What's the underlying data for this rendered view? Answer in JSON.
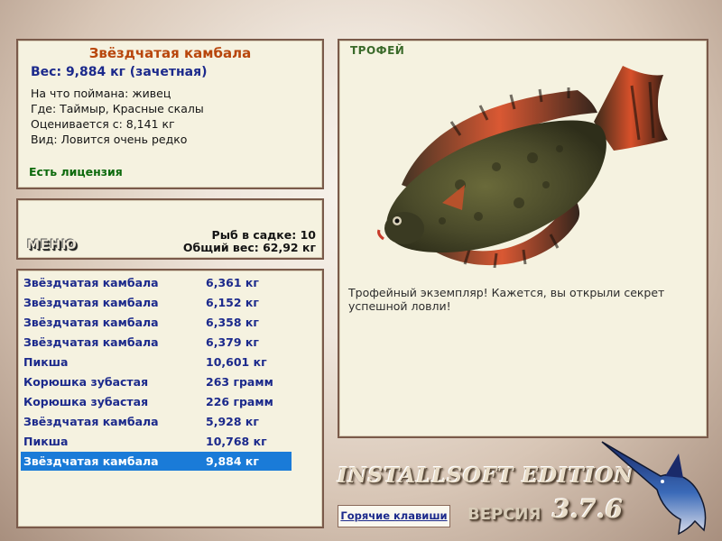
{
  "info": {
    "fish_name": "Звёздчатая камбала",
    "weight": "Вес: 9,884 кг (зачетная)",
    "bait": "На что поймана: живец",
    "location": "Где: Таймыр, Красные скалы",
    "valued_from": "Оценивается с: 8,141 кг",
    "species_note": "Вид: Ловится очень редко",
    "license": "Есть лицензия"
  },
  "menu": {
    "menu_label": "МЕНЮ",
    "fish_in_cage": "Рыб в садке: 10",
    "total_weight": "Общий вес: 62,92 кг"
  },
  "catch_list": [
    {
      "name": "Звёздчатая камбала",
      "weight": "6,361 кг"
    },
    {
      "name": "Звёздчатая камбала",
      "weight": "6,152 кг"
    },
    {
      "name": "Звёздчатая камбала",
      "weight": "6,358 кг"
    },
    {
      "name": "Звёздчатая камбала",
      "weight": "6,379 кг"
    },
    {
      "name": "Пикша",
      "weight": "10,601 кг"
    },
    {
      "name": "Корюшка зубастая",
      "weight": "263 грамм"
    },
    {
      "name": "Корюшка зубастая",
      "weight": "226 грамм"
    },
    {
      "name": "Звёздчатая камбала",
      "weight": "5,928 кг"
    },
    {
      "name": "Пикша",
      "weight": "10,768 кг"
    },
    {
      "name": "Звёздчатая камбала",
      "weight": "9,884 кг"
    }
  ],
  "selected_index": 9,
  "trophy": {
    "title": "ТРОФЕЙ",
    "description": "Трофейный экземпляр! Кажется, вы открыли секрет успешной ловли!"
  },
  "footer": {
    "hotkeys": "Горячие клавиши",
    "brand": "INSTALLSOFT EDITION",
    "version_label": "ВЕРСИЯ",
    "version_number": "3.7.6"
  },
  "colors": {
    "panel_bg": "#f5f2e0",
    "title_orange": "#b8460c",
    "text_blue": "#1c2a8c",
    "license_green": "#0d6a0d",
    "selection_blue": "#1a7bd8"
  },
  "icons": {
    "fish_image": "starry-flounder-image",
    "marlin_logo": "marlin-logo"
  }
}
